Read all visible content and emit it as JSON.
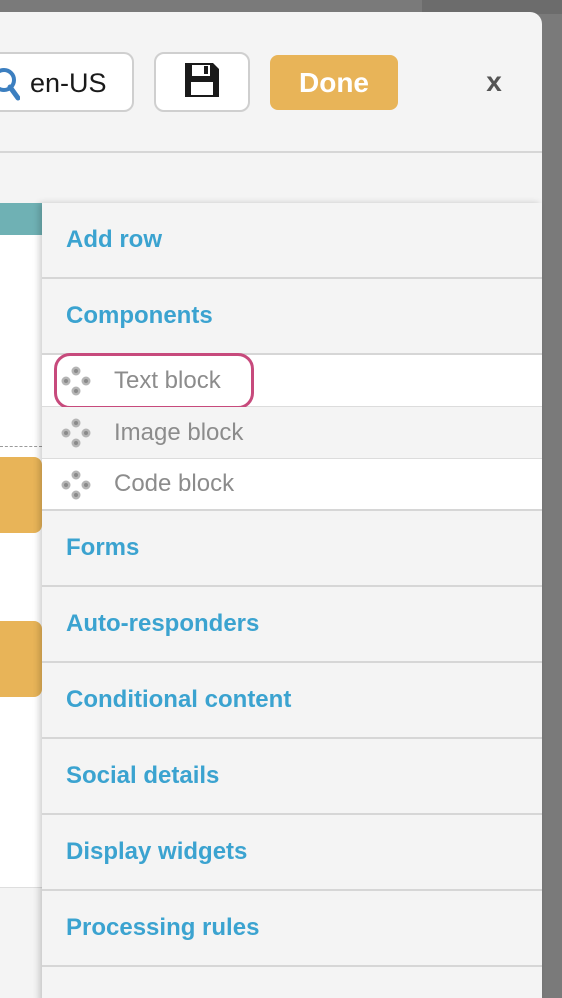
{
  "toolbar": {
    "language": "en-US",
    "save_icon": "floppy-disk-icon",
    "done_label": "Done",
    "close_label": "x"
  },
  "menu": {
    "sections_top": [
      {
        "label": "Add row"
      },
      {
        "label": "Components"
      }
    ],
    "components": [
      {
        "label": "Text block",
        "icon": "drag-move-icon"
      },
      {
        "label": "Image block",
        "icon": "drag-move-icon"
      },
      {
        "label": "Code block",
        "icon": "drag-move-icon"
      }
    ],
    "sections_bottom": [
      {
        "label": "Forms"
      },
      {
        "label": "Auto-responders"
      },
      {
        "label": "Conditional content"
      },
      {
        "label": "Social details"
      },
      {
        "label": "Display widgets"
      },
      {
        "label": "Processing rules"
      }
    ]
  },
  "colors": {
    "accent_link": "#3ba3d0",
    "done_button": "#e8b458",
    "highlight_ring": "#c74a7c",
    "teal_strip": "#6fb1b4"
  }
}
